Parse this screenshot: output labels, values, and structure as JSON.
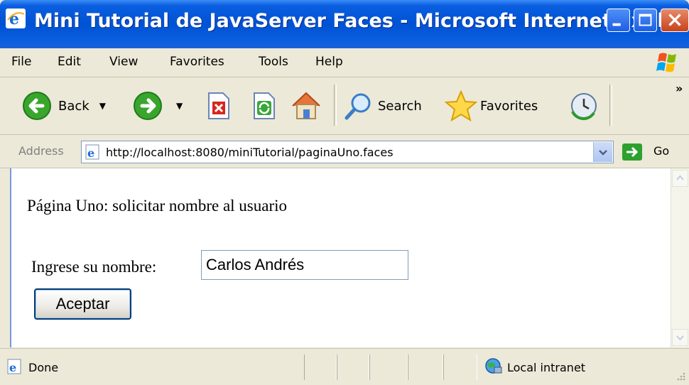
{
  "window": {
    "title": "Mini Tutorial de JavaServer Faces - Microsoft Internet Explo...",
    "title_bar_color": "#0a5ee0"
  },
  "menu": {
    "items": [
      "File",
      "Edit",
      "View",
      "Favorites",
      "Tools",
      "Help"
    ]
  },
  "toolbar": {
    "back_label": "Back",
    "search_label": "Search",
    "favorites_label": "Favorites",
    "overflow": "»"
  },
  "address": {
    "label": "Address",
    "url": "http://localhost:8080/miniTutorial/paginaUno.faces",
    "go_label": "Go"
  },
  "page": {
    "heading": "Página Uno: solicitar nombre al usuario",
    "form_label": "Ingrese su nombre:",
    "name_value": "Carlos Andrés",
    "submit_label": "Aceptar"
  },
  "status": {
    "text": "Done",
    "zone": "Local intranet"
  }
}
